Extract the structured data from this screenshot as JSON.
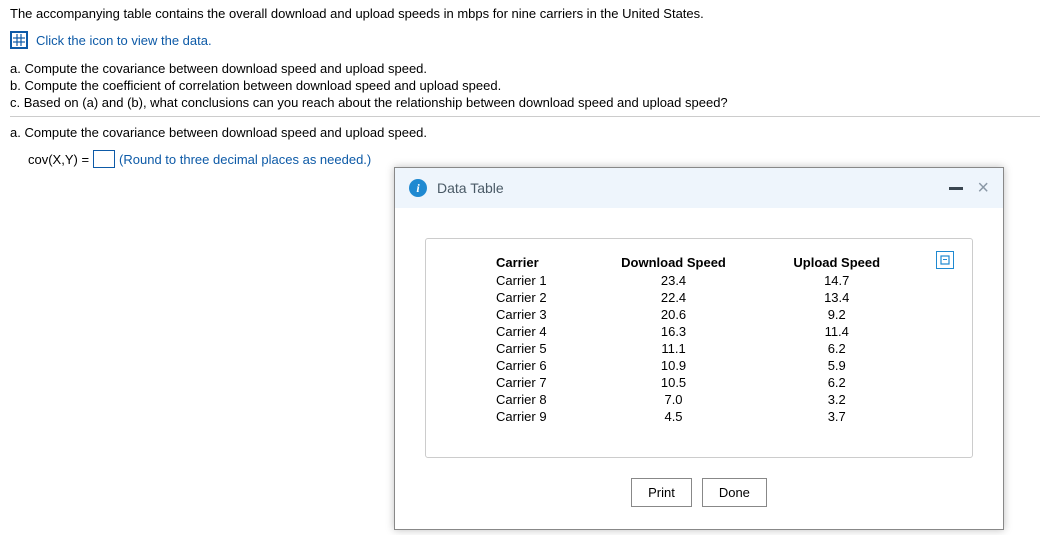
{
  "intro": "The accompanying table contains the overall download and upload speeds in mbps for nine carriers in the United States.",
  "icon_hint": "Click the icon to view the data.",
  "questions": {
    "a": "a. Compute the covariance between download speed and upload speed.",
    "b": "b. Compute the coefficient of correlation between download speed and upload speed.",
    "c": "c. Based on (a) and (b), what conclusions can you reach about the relationship between download speed and upload speed?"
  },
  "sub_a": "a. Compute the covariance between download speed and upload speed.",
  "cov_label": "cov(X,Y) =",
  "cov_hint": "(Round to three decimal places as needed.)",
  "modal": {
    "title": "Data Table",
    "print": "Print",
    "done": "Done"
  },
  "table": {
    "headers": [
      "Carrier",
      "Download Speed",
      "Upload Speed"
    ],
    "rows": [
      [
        "Carrier 1",
        "23.4",
        "14.7"
      ],
      [
        "Carrier 2",
        "22.4",
        "13.4"
      ],
      [
        "Carrier 3",
        "20.6",
        "9.2"
      ],
      [
        "Carrier 4",
        "16.3",
        "11.4"
      ],
      [
        "Carrier 5",
        "11.1",
        "6.2"
      ],
      [
        "Carrier 6",
        "10.9",
        "5.9"
      ],
      [
        "Carrier 7",
        "10.5",
        "6.2"
      ],
      [
        "Carrier 8",
        "7.0",
        "3.2"
      ],
      [
        "Carrier 9",
        "4.5",
        "3.7"
      ]
    ]
  },
  "chart_data": {
    "type": "table",
    "title": "Data Table",
    "columns": [
      "Carrier",
      "Download Speed",
      "Upload Speed"
    ],
    "rows": [
      {
        "Carrier": "Carrier 1",
        "Download Speed": 23.4,
        "Upload Speed": 14.7
      },
      {
        "Carrier": "Carrier 2",
        "Download Speed": 22.4,
        "Upload Speed": 13.4
      },
      {
        "Carrier": "Carrier 3",
        "Download Speed": 20.6,
        "Upload Speed": 9.2
      },
      {
        "Carrier": "Carrier 4",
        "Download Speed": 16.3,
        "Upload Speed": 11.4
      },
      {
        "Carrier": "Carrier 5",
        "Download Speed": 11.1,
        "Upload Speed": 6.2
      },
      {
        "Carrier": "Carrier 6",
        "Download Speed": 10.9,
        "Upload Speed": 5.9
      },
      {
        "Carrier": "Carrier 7",
        "Download Speed": 10.5,
        "Upload Speed": 6.2
      },
      {
        "Carrier": "Carrier 8",
        "Download Speed": 7.0,
        "Upload Speed": 3.2
      },
      {
        "Carrier": "Carrier 9",
        "Download Speed": 4.5,
        "Upload Speed": 3.7
      }
    ]
  }
}
